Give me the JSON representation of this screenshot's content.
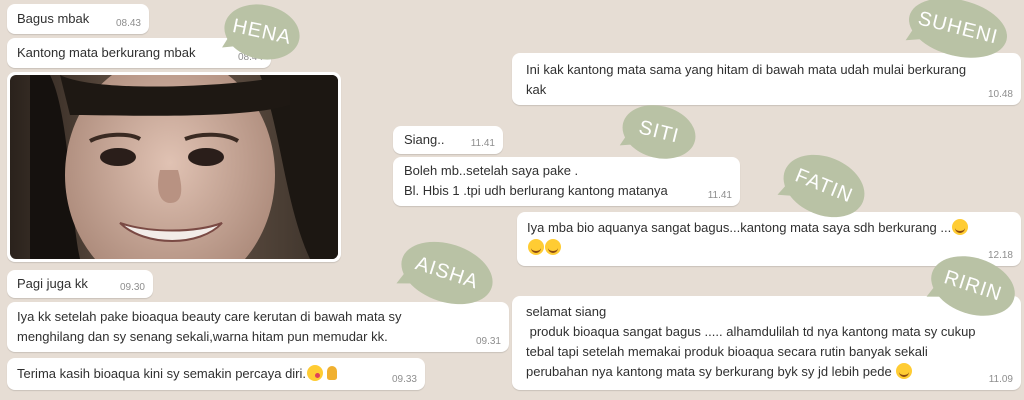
{
  "labels": {
    "hena": "HENA",
    "suheni": "SUHENI",
    "siti": "SITI",
    "fatin": "FATIN",
    "aisha": "AISHA",
    "ririn": "RIRIN"
  },
  "colors": {
    "tag": "#b9c2a5",
    "background": "#e6ddd4",
    "bubble": "#ffffff"
  },
  "left": {
    "m1": {
      "text": "Bagus mbak",
      "time": "08.43"
    },
    "m2": {
      "text": "Kantong mata berkurang mbak",
      "time": "08.44"
    },
    "m3": {
      "text": "Pagi juga kk",
      "time": "09.30"
    },
    "m4": {
      "text": "Iya kk setelah pake bioaqua beauty care kerutan di bawah mata sy\nmenghilang dan sy senang sekali,warna hitam pun memudar kk.",
      "time": "09.31"
    },
    "m5": {
      "text": "Terima kasih bioaqua kini sy semakin percaya diri.",
      "time": "09.33"
    }
  },
  "right": {
    "s1": {
      "text": "Ini kak kantong mata sama yang hitam di bawah mata udah mulai berkurang\nkak",
      "time": "10.48"
    },
    "s2": {
      "text": "Siang..",
      "time": "11.41"
    },
    "s3": {
      "text": "Boleh mb..setelah saya pake .\nBl. Hbis 1 .tpi udh berlurang kantong matanya",
      "time": "11.41"
    },
    "s4": {
      "text": "Iya mba bio aquanya sangat bagus...kantong mata saya sdh berkurang ...",
      "time": "12.18"
    },
    "s5": {
      "text": "selamat siang\n produk bioaqua sangat bagus ..... alhamdulilah td nya kantong mata sy cukup\ntebal tapi setelah memakai produk bioaqua secara rutin banyak sekali\nperubahan nya kantong mata sy berkurang byk sy jd lebih pede ",
      "time": "11.09"
    }
  },
  "icons": [
    "smile-emoji-icon",
    "kiss-emoji-icon",
    "praying-hands-icon",
    "grin-emoji-icon"
  ]
}
